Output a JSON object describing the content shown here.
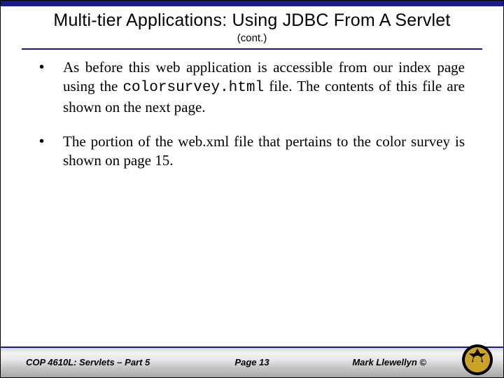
{
  "header": {
    "title": "Multi-tier Applications:  Using JDBC From A Servlet",
    "subtitle": "(cont.)"
  },
  "bullets": [
    {
      "pre": "As before this web application is accessible from our index page using the ",
      "code": "colorsurvey.html",
      "post": " file.  The contents of this file are shown on the next page."
    },
    {
      "pre": "The portion of the web.xml file that pertains to the color survey is shown on page 15.",
      "code": "",
      "post": ""
    }
  ],
  "footer": {
    "left": "COP 4610L: Servlets – Part 5",
    "center": "Page 13",
    "right": "Mark Llewellyn ©"
  }
}
